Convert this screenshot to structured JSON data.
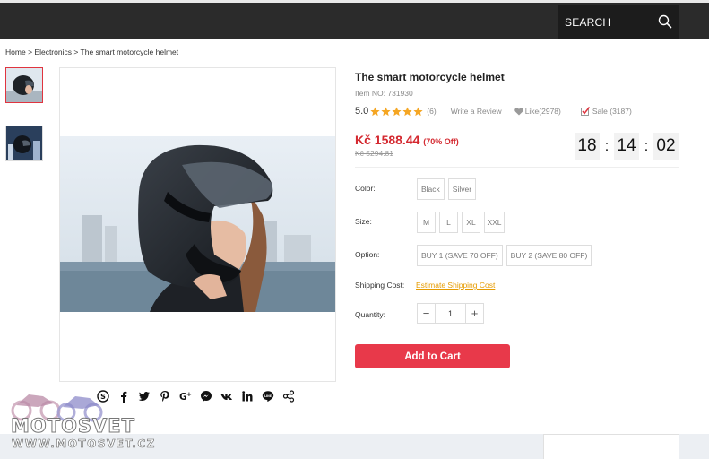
{
  "header": {
    "search_label": "SEARCH",
    "search_icon": "search-icon",
    "background": "#2b2b2b"
  },
  "breadcrumb": {
    "home": "Home",
    "category": "Electronics",
    "current": "The smart motorcycle helmet",
    "separator": ">"
  },
  "gallery": {
    "thumbnails": [
      {
        "name": "helmet-woman-thumbnail",
        "active": true
      },
      {
        "name": "helmet-city-night-thumbnail",
        "active": false
      }
    ],
    "main_image": "motorcycle-helmet-photo"
  },
  "share": {
    "icons": [
      "skype-icon",
      "facebook-icon",
      "twitter-icon",
      "pinterest-icon",
      "google-plus-icon",
      "messenger-icon",
      "vk-icon",
      "linkedin-icon",
      "line-icon",
      "share-icon"
    ]
  },
  "product": {
    "title": "The smart motorcycle helmet",
    "item_no": "Item NO: 731930",
    "rating": "5.0",
    "stars": 5,
    "review_count": "(6)",
    "write_review": "Write a Review",
    "like": "Like(2978)",
    "sale": "Sale (3187)",
    "price": "Kč 1588.44",
    "discount": "(70% Off)",
    "old_price": "Kč 5294.81",
    "countdown": {
      "hours": "18",
      "minutes": "14",
      "seconds": "02",
      "separator": ":"
    }
  },
  "options": {
    "color_label": "Color:",
    "colors": [
      "Black",
      "Silver"
    ],
    "size_label": "Size:",
    "sizes": [
      "M",
      "L",
      "XL",
      "XXL"
    ],
    "option_label": "Option:",
    "option_choices": [
      "BUY 1 (SAVE 70 OFF)",
      "BUY 2 (SAVE 80 OFF)"
    ],
    "shipping_label": "Shipping Cost:",
    "shipping_link": "Estimate Shipping Cost",
    "quantity_label": "Quantity:",
    "quantity_minus": "−",
    "quantity_value": "1",
    "quantity_plus": "+"
  },
  "cart": {
    "add_to_cart": "Add to Cart",
    "button_color": "#e8394a"
  },
  "watermark": {
    "name": "MOTOSVET",
    "url": "WWW.MOTOSVET.CZ"
  },
  "colors": {
    "accent_red": "#d4282f",
    "star_orange": "#f5a623",
    "link_orange": "#e69b00"
  }
}
